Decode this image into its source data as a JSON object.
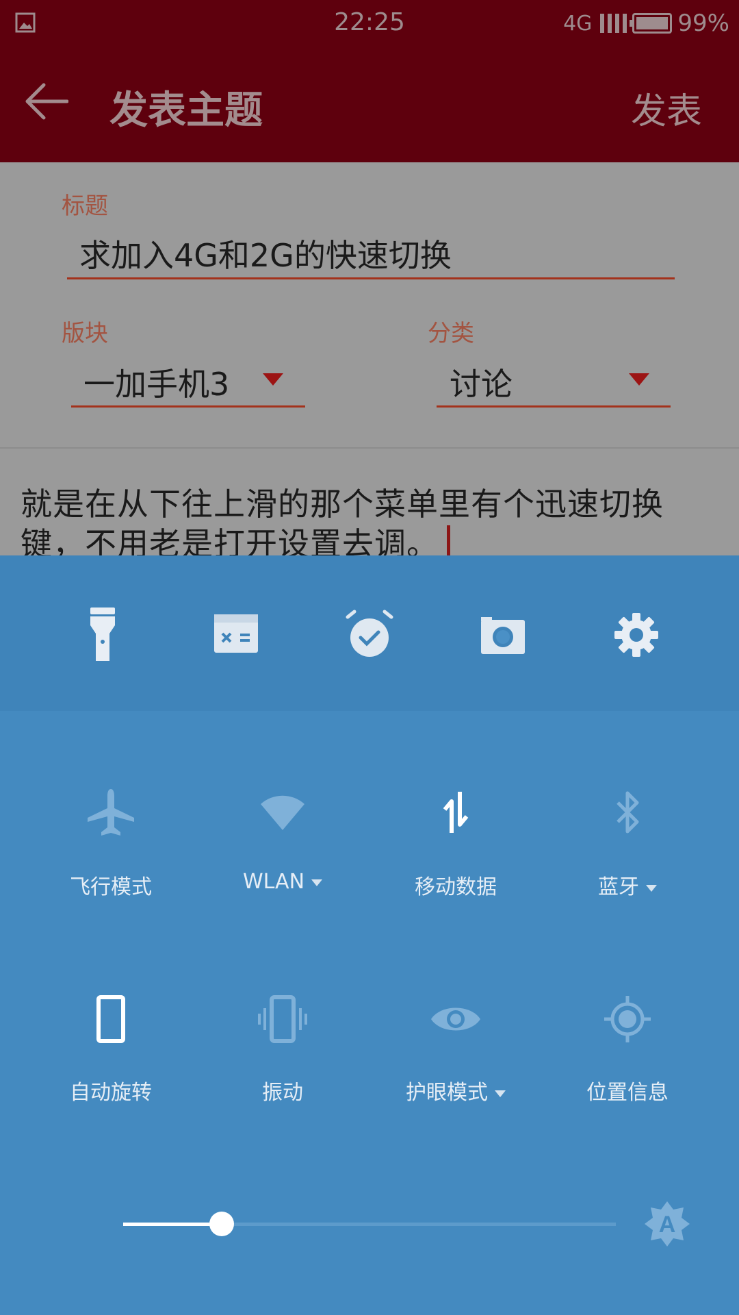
{
  "status_bar": {
    "time": "22:25",
    "network": "4G",
    "battery": "99%"
  },
  "app_bar": {
    "back_icon": "arrow-left-icon",
    "title": "发表主题",
    "action": "发表"
  },
  "form": {
    "title_label": "标题",
    "title_value": "求加入4G和2G的快速切换",
    "board_label": "版块",
    "board_value": "一加手机3",
    "category_label": "分类",
    "category_value": "讨论",
    "content": "就是在从下往上滑的那个菜单里有个迅速切换键，不用老是打开设置去调。"
  },
  "quick_panel": {
    "shortcuts": [
      {
        "icon": "flashlight-icon"
      },
      {
        "icon": "calculator-icon"
      },
      {
        "icon": "alarm-icon"
      },
      {
        "icon": "camera-icon"
      },
      {
        "icon": "settings-gear-icon"
      }
    ],
    "toggles": [
      {
        "label": "飞行模式",
        "icon": "airplane-icon",
        "active": false,
        "dropdown": false
      },
      {
        "label": "WLAN",
        "icon": "wifi-icon",
        "active": false,
        "dropdown": true
      },
      {
        "label": "移动数据",
        "icon": "mobile-data-icon",
        "active": true,
        "dropdown": false
      },
      {
        "label": "蓝牙",
        "icon": "bluetooth-icon",
        "active": false,
        "dropdown": true
      },
      {
        "label": "自动旋转",
        "icon": "auto-rotate-icon",
        "active": true,
        "dropdown": false
      },
      {
        "label": "振动",
        "icon": "vibrate-icon",
        "active": false,
        "dropdown": false
      },
      {
        "label": "护眼模式",
        "icon": "eye-icon",
        "active": false,
        "dropdown": true
      },
      {
        "label": "位置信息",
        "icon": "location-icon",
        "active": false,
        "dropdown": false
      }
    ],
    "brightness": {
      "level": 0.2,
      "low_icon": "brightness-low-icon",
      "auto_icon": "auto-brightness-icon",
      "auto_letter": "A"
    }
  }
}
